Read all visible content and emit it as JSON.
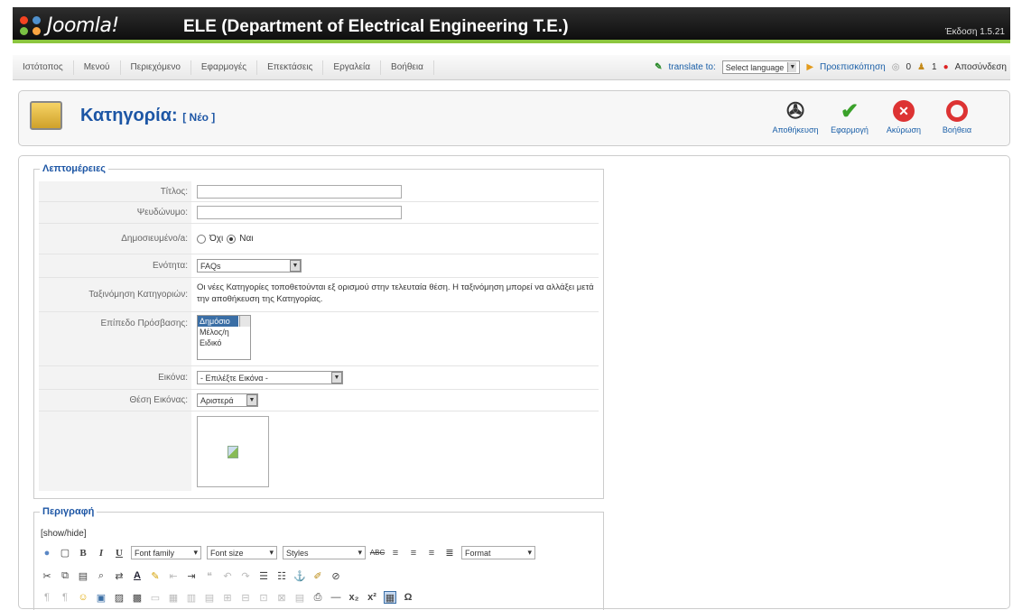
{
  "header": {
    "logo_text": "Joomla!",
    "site_name": "ELE (Department of Electrical Engineering T.E.)",
    "version": "Έκδοση 1.5.21"
  },
  "menu": {
    "items": [
      "Ιστότοπος",
      "Μενού",
      "Περιεχόμενο",
      "Εφαρμογές",
      "Επεκτάσεις",
      "Εργαλεία",
      "Βοήθεια"
    ],
    "translate_label": "translate to:",
    "language_select": "Select language",
    "preview": "Προεπισκόπηση",
    "messages_count": "0",
    "users_count": "1",
    "logout": "Αποσύνδεση"
  },
  "toolbar": {
    "title": "Κατηγορία:",
    "subtitle": "[ Νέο ]",
    "save": "Αποθήκευση",
    "apply": "Εφαρμογή",
    "cancel": "Ακύρωση",
    "help": "Βοήθεια"
  },
  "details": {
    "legend": "Λεπτομέρειες",
    "title_label": "Τίτλος:",
    "title_value": "",
    "alias_label": "Ψευδώνυμο:",
    "alias_value": "",
    "published_label": "Δημοσιευμένο/a:",
    "published_no": "Όχι",
    "published_yes": "Ναι",
    "section_label": "Ενότητα:",
    "section_value": "FAQs",
    "ordering_label": "Ταξινόμηση Κατηγοριών:",
    "ordering_text": "Οι νέες Κατηγορίες τοποθετούνται εξ ορισμού στην τελευταία θέση. Η ταξινόμηση μπορεί να αλλάξει μετά την αποθήκευση της Κατηγορίας.",
    "access_label": "Επίπεδο Πρόσβασης:",
    "access_options": [
      "Δημόσιο",
      "Μέλος/η",
      "Ειδικό"
    ],
    "image_label": "Εικόνα:",
    "image_value": "- Επιλέξτε Εικόνα -",
    "image_position_label": "Θέση Εικόνας:",
    "image_position_value": "Αριστερά"
  },
  "description": {
    "legend": "Περιγραφή",
    "show_hide": "[show/hide]",
    "font_family": "Font family",
    "font_size": "Font size",
    "styles": "Styles",
    "format": "Format"
  },
  "colors": {
    "accent": "#1d56a5",
    "header_bg": "#1a1a1a",
    "header_stripe": "#8cc63f"
  }
}
